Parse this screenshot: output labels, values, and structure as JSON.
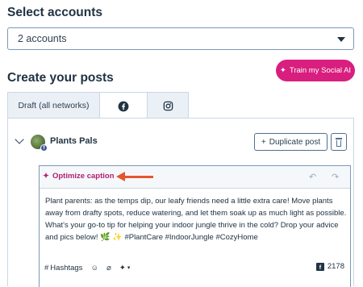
{
  "select_accounts": {
    "title": "Select accounts",
    "value": "2 accounts"
  },
  "create": {
    "title": "Create your posts",
    "train_button": "Train my Social AI",
    "train_icon": "sparkle-icon"
  },
  "tabs": [
    {
      "label": "Draft (all networks)",
      "active": false
    },
    {
      "label": "",
      "icon": "facebook-icon",
      "active": true
    },
    {
      "label": "",
      "icon": "instagram-icon",
      "active": false
    }
  ],
  "post": {
    "account_name": "Plants Pals",
    "duplicate_button": "Duplicate post",
    "optimize_label": "Optimize caption",
    "text_main": "Plant parents: as the temps dip, our leafy friends need a little extra care! Move plants away from drafty spots, reduce watering, and let them soak up as much light as possible. What's your go-to tip for helping your indoor jungle thrive in the cold? Drop your advice and pics below!",
    "text_emojis": "🌿 ✨",
    "text_hashtags": "#PlantCare #IndoorJungle #CozyHome",
    "hashtags_button": "Hashtags",
    "char_count": "2178"
  },
  "colors": {
    "brand_pink": "#d81e7e",
    "annotation_arrow": "#e4572e",
    "text_dark": "#213343"
  }
}
